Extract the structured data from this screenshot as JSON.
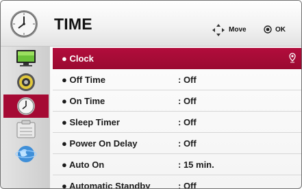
{
  "header": {
    "title": "TIME",
    "move_label": "Move",
    "ok_label": "OK"
  },
  "sidebar": {
    "items": [
      {
        "icon": "picture-icon"
      },
      {
        "icon": "audio-icon"
      },
      {
        "icon": "time-icon",
        "active": true
      },
      {
        "icon": "option-icon"
      },
      {
        "icon": "network-icon"
      }
    ]
  },
  "menu": {
    "items": [
      {
        "label": "● Clock",
        "value": ""
      },
      {
        "label": "● Off Time",
        "value": ": Off"
      },
      {
        "label": "● On Time",
        "value": ": Off"
      },
      {
        "label": "● Sleep Timer",
        "value": ": Off"
      },
      {
        "label": "● Power On Delay",
        "value": ": Off"
      },
      {
        "label": "● Auto On",
        "value": ": 15 min."
      },
      {
        "label": "● Automatic Standby",
        "value": ": Off"
      }
    ]
  },
  "colors": {
    "accent": "#a50a34",
    "text": "#1a1a1a",
    "background": "#ffffff"
  }
}
